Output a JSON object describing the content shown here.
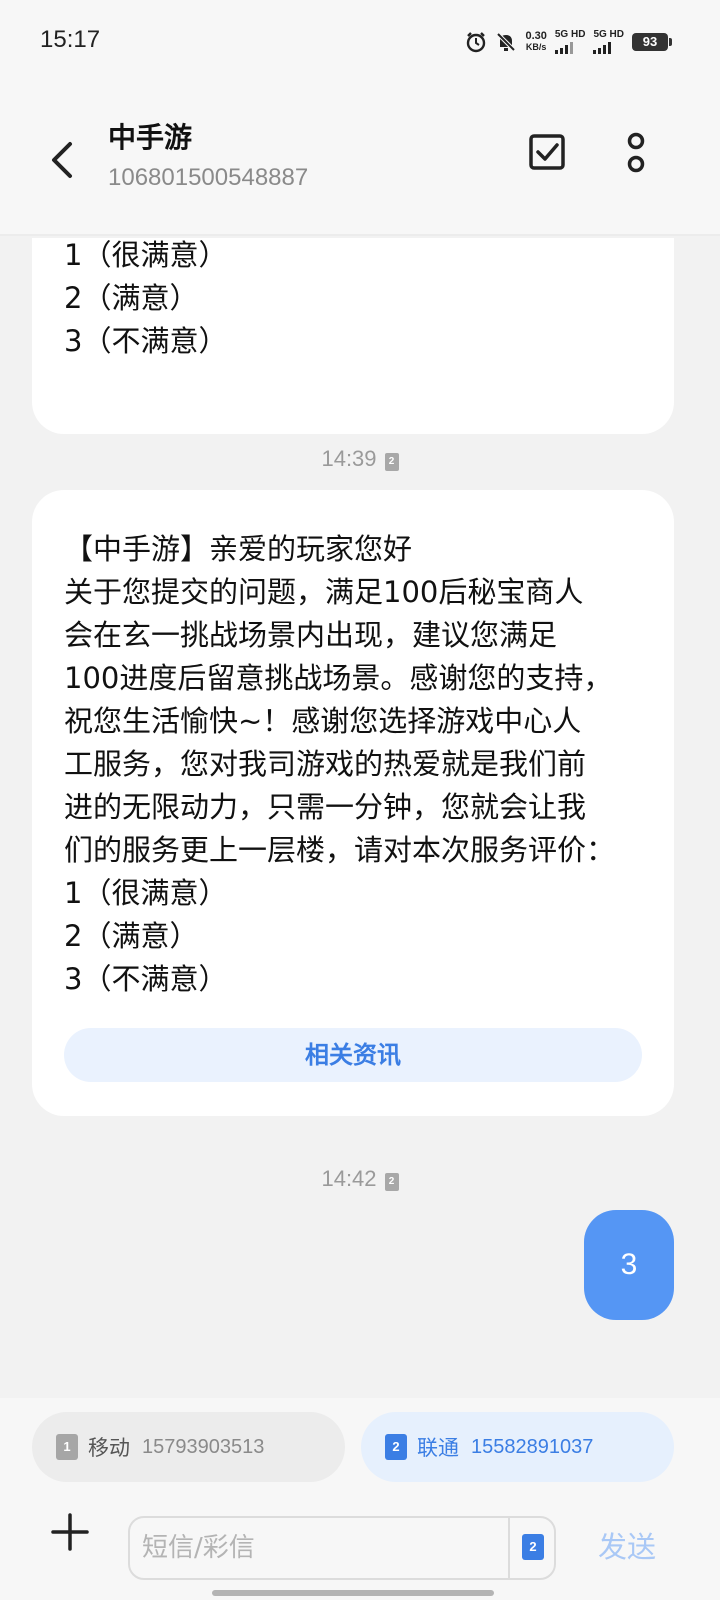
{
  "status_bar": {
    "time": "15:17",
    "net_speed_value": "0.30",
    "net_speed_unit": "KB/s",
    "sim1_label": "5G HD",
    "sim2_label": "5G HD",
    "battery": "93"
  },
  "header": {
    "contact_name": "中手游",
    "contact_number": "106801500548887"
  },
  "messages": {
    "partial_top_lines": [
      "1（很满意）",
      "2（满意）",
      "3（不满意）"
    ],
    "timestamp_1": "14:39",
    "timestamp_1_sim": "2",
    "message_2_lines": [
      "【中手游】亲爱的玩家您好",
      "关于您提交的问题，满足100后秘宝商人",
      "会在玄一挑战场景内出现，建议您满足",
      "100进度后留意挑战场景。感谢您的支持，",
      "祝您生活愉快~！感谢您选择游戏中心人",
      "工服务，您对我司游戏的热爱就是我们前",
      "进的无限动力，只需一分钟，您就会让我",
      "们的服务更上一层楼，请对本次服务评价：",
      "1（很满意）",
      "2（满意）",
      "3（不满意）"
    ],
    "related_info_label": "相关资讯",
    "timestamp_2": "14:42",
    "timestamp_2_sim": "2",
    "outgoing_reply": "3"
  },
  "sim_selector": {
    "sim1": {
      "slot": "1",
      "carrier": "移动",
      "number": "15793903513"
    },
    "sim2": {
      "slot": "2",
      "carrier": "联通",
      "number": "15582891037"
    }
  },
  "composer": {
    "placeholder": "短信/彩信",
    "sim_slot": "2",
    "send_label": "发送"
  },
  "colors": {
    "accent": "#3b7ee4",
    "outgoing_bubble": "#5596f4",
    "background": "#f2f2f2"
  }
}
